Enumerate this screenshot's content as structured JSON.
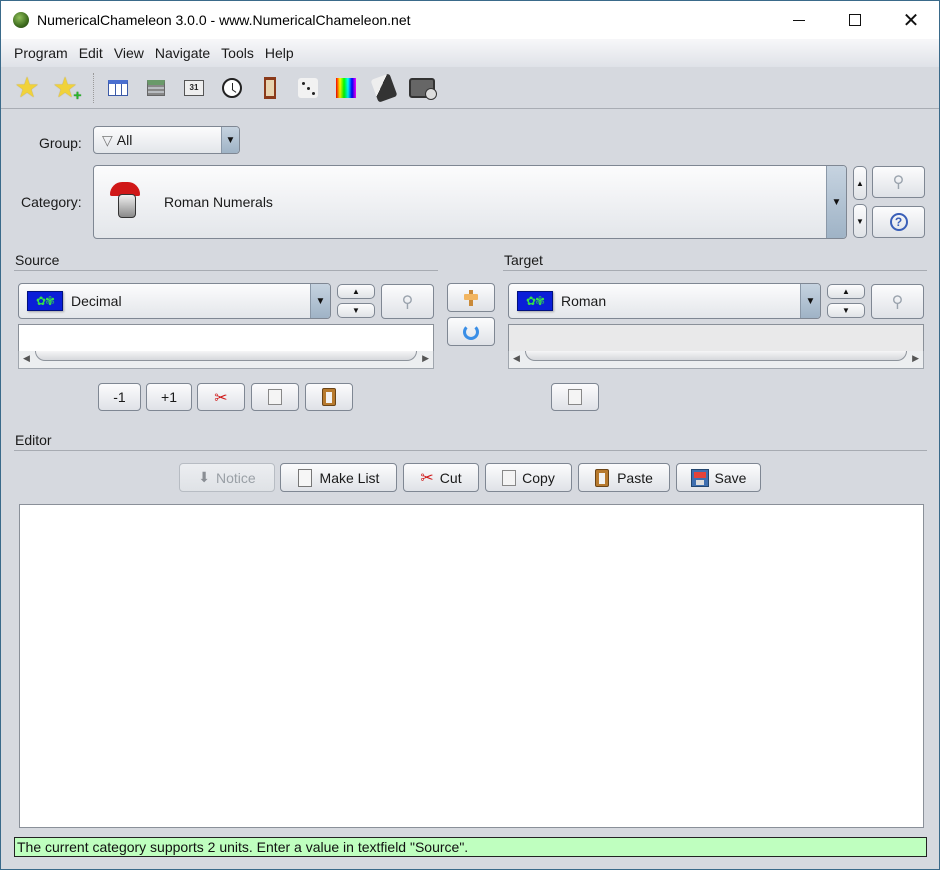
{
  "window": {
    "title": "NumericalChameleon 3.0.0 - www.NumericalChameleon.net",
    "controls": {
      "minimize": "minimize-icon",
      "maximize": "maximize-icon",
      "close": "close-icon"
    }
  },
  "menubar": {
    "items": [
      {
        "label": "Program"
      },
      {
        "label": "Edit"
      },
      {
        "label": "View"
      },
      {
        "label": "Navigate"
      },
      {
        "label": "Tools"
      },
      {
        "label": "Help"
      }
    ]
  },
  "toolbar": {
    "icons": [
      "favorites-star-icon",
      "add-favorite-icon",
      "table-icon",
      "calculator-icon",
      "calendar-icon",
      "clock-icon",
      "hourglass-icon",
      "dice-icon",
      "color-palette-icon",
      "phone-icon",
      "money-icon"
    ],
    "calendar_day": "31"
  },
  "group": {
    "label": "Group:",
    "value": "All",
    "icon": "funnel-icon"
  },
  "category": {
    "label": "Category:",
    "value": "Roman Numerals",
    "icon": "roman-helmet-icon"
  },
  "source": {
    "title": "Source",
    "unit": "Decimal",
    "value": "",
    "buttons": {
      "decrement": "-1",
      "increment": "+1"
    }
  },
  "target": {
    "title": "Target",
    "unit": "Roman",
    "value": ""
  },
  "flag_text": "map",
  "editor": {
    "title": "Editor",
    "buttons": {
      "notice": "Notice",
      "make_list": "Make List",
      "cut": "Cut",
      "copy": "Copy",
      "paste": "Paste",
      "save": "Save"
    },
    "content": ""
  },
  "status": {
    "message": "The current category supports 2 units. Enter a value in textfield \"Source\".",
    "color": "#bfffbf"
  },
  "glyphs": {
    "star": "★",
    "plus": "+",
    "arrow_down": "▼",
    "arrow_up_small": "▲",
    "arrow_down_small": "▼",
    "arrow_left": "◀",
    "arrow_right": "▶",
    "magnifier": "🔍",
    "help": "?",
    "scissors": "✂",
    "down_arrow": "🡇",
    "close": "✕"
  }
}
